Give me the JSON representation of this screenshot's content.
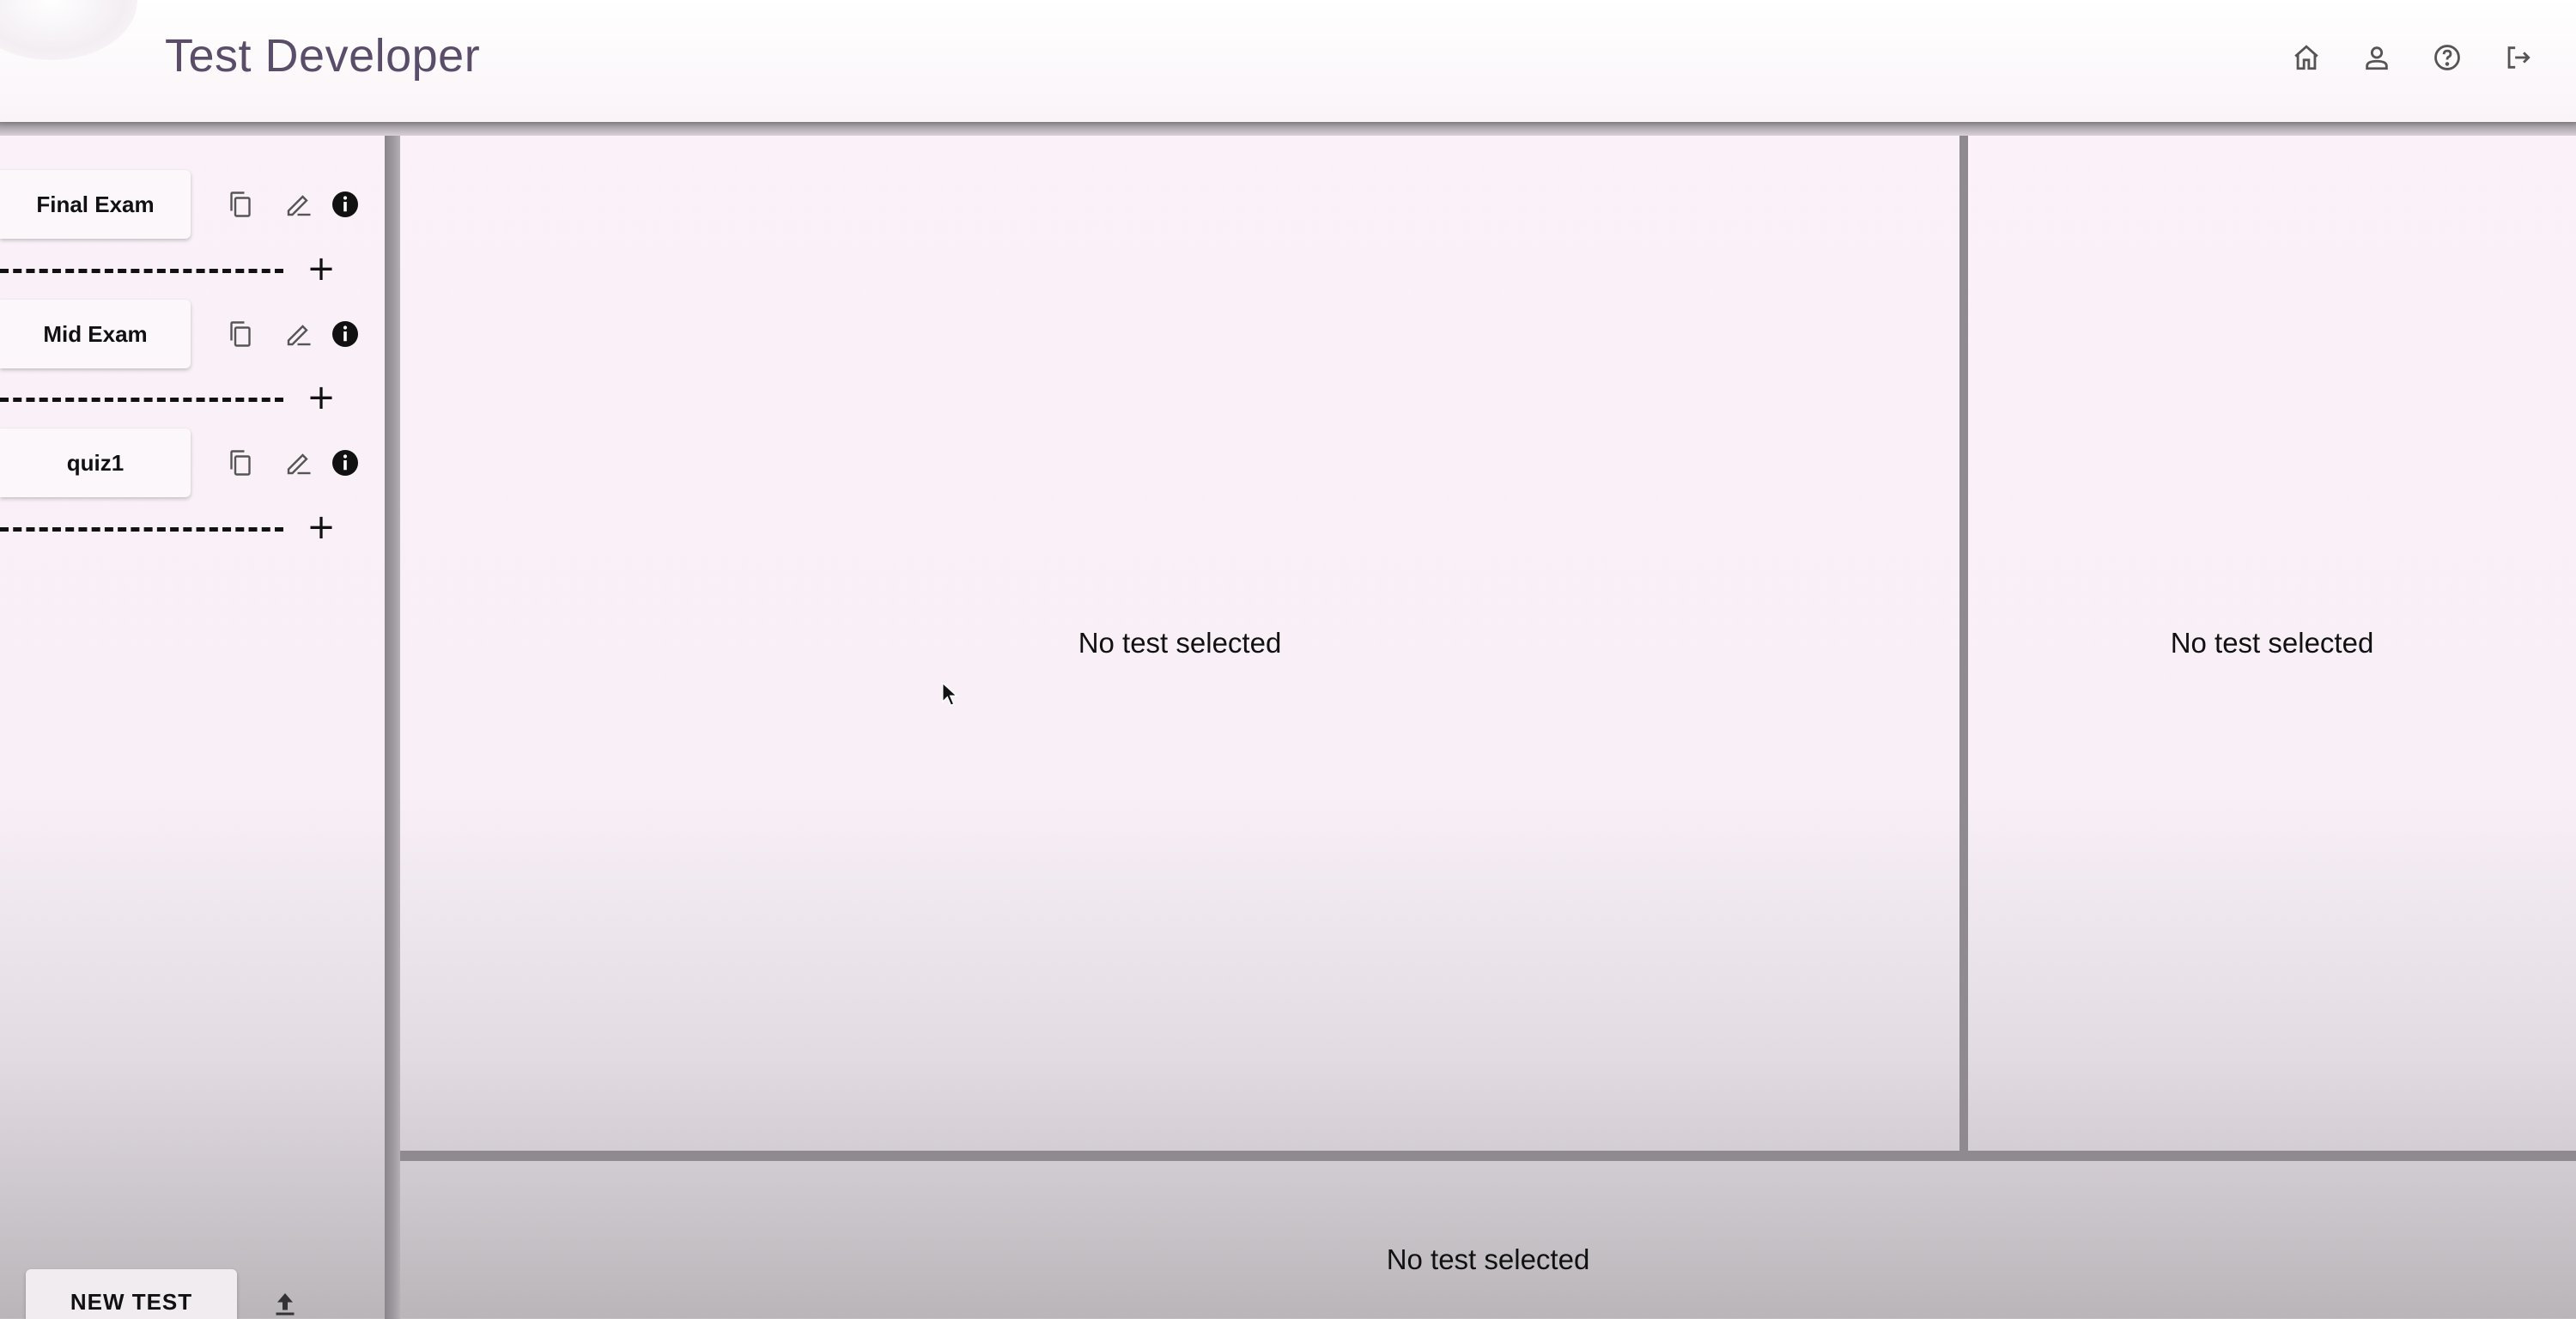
{
  "header": {
    "title": "Test Developer",
    "icons": [
      "home-icon",
      "user-icon",
      "help-icon",
      "logout-icon"
    ]
  },
  "sidebar": {
    "tests": [
      {
        "label": "Final Exam"
      },
      {
        "label": "Mid Exam"
      },
      {
        "label": "quiz1"
      }
    ],
    "row_icons": [
      "copy-icon",
      "edit-icon",
      "info-icon"
    ],
    "add_symbol": "+",
    "new_test_label": "NEW TEST"
  },
  "panels": {
    "main_text": "No test selected",
    "side_text": "No test selected",
    "bottom_text": "No test selected"
  },
  "colors": {
    "title": "#5a4d6a",
    "divider": "#8f8a8f",
    "background": "#faf2f8"
  }
}
